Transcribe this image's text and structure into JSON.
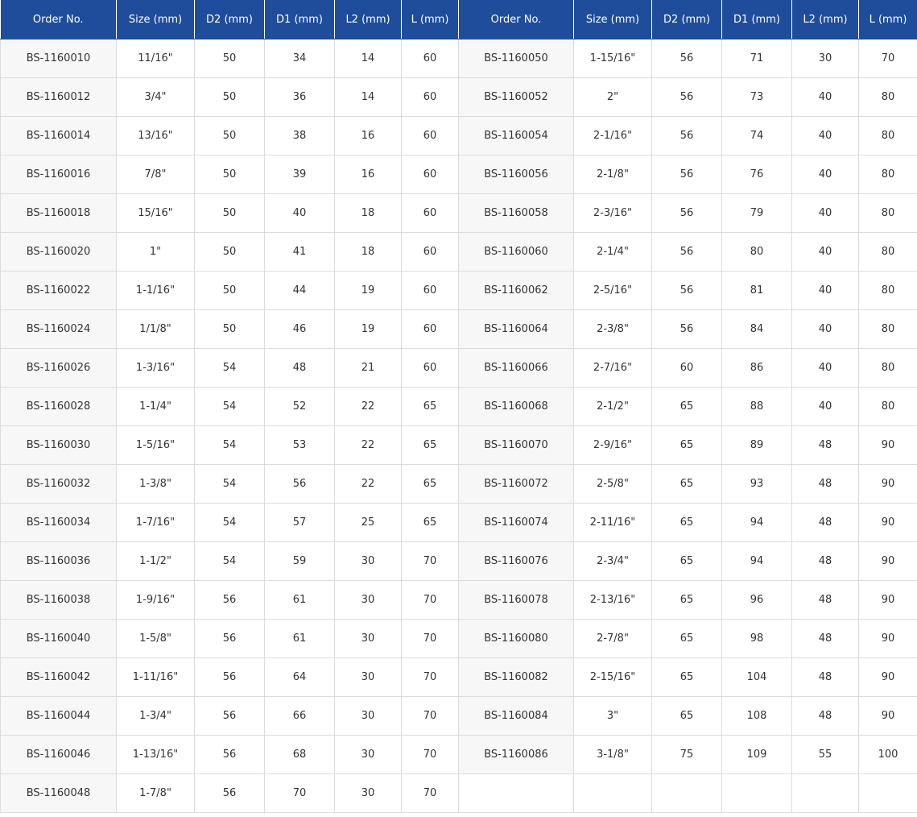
{
  "headers": [
    "Order No.",
    "Size (mm)",
    "D2 (mm)",
    "D1 (mm)",
    "L2 (mm)",
    "L (mm)",
    "Order No.",
    "Size (mm)",
    "D2 (mm)",
    "D1 (mm)",
    "L2 (mm)",
    "L (mm)"
  ],
  "rows": [
    [
      "BS-1160010",
      "11/16\"",
      "50",
      "34",
      "14",
      "60",
      "BS-1160050",
      "1-15/16\"",
      "56",
      "71",
      "30",
      "70"
    ],
    [
      "BS-1160012",
      "3/4\"",
      "50",
      "36",
      "14",
      "60",
      "BS-1160052",
      "2\"",
      "56",
      "73",
      "40",
      "80"
    ],
    [
      "BS-1160014",
      "13/16\"",
      "50",
      "38",
      "16",
      "60",
      "BS-1160054",
      "2-1/16\"",
      "56",
      "74",
      "40",
      "80"
    ],
    [
      "BS-1160016",
      "7/8\"",
      "50",
      "39",
      "16",
      "60",
      "BS-1160056",
      "2-1/8\"",
      "56",
      "76",
      "40",
      "80"
    ],
    [
      "BS-1160018",
      "15/16\"",
      "50",
      "40",
      "18",
      "60",
      "BS-1160058",
      "2-3/16\"",
      "56",
      "79",
      "40",
      "80"
    ],
    [
      "BS-1160020",
      "1\"",
      "50",
      "41",
      "18",
      "60",
      "BS-1160060",
      "2-1/4\"",
      "56",
      "80",
      "40",
      "80"
    ],
    [
      "BS-1160022",
      "1-1/16\"",
      "50",
      "44",
      "19",
      "60",
      "BS-1160062",
      "2-5/16\"",
      "56",
      "81",
      "40",
      "80"
    ],
    [
      "BS-1160024",
      "1/1/8\"",
      "50",
      "46",
      "19",
      "60",
      "BS-1160064",
      "2-3/8\"",
      "56",
      "84",
      "40",
      "80"
    ],
    [
      "BS-1160026",
      "1-3/16\"",
      "54",
      "48",
      "21",
      "60",
      "BS-1160066",
      "2-7/16\"",
      "60",
      "86",
      "40",
      "80"
    ],
    [
      "BS-1160028",
      "1-1/4\"",
      "54",
      "52",
      "22",
      "65",
      "BS-1160068",
      "2-1/2\"",
      "65",
      "88",
      "40",
      "80"
    ],
    [
      "BS-1160030",
      "1-5/16\"",
      "54",
      "53",
      "22",
      "65",
      "BS-1160070",
      "2-9/16\"",
      "65",
      "89",
      "48",
      "90"
    ],
    [
      "BS-1160032",
      "1-3/8\"",
      "54",
      "56",
      "22",
      "65",
      "BS-1160072",
      "2-5/8\"",
      "65",
      "93",
      "48",
      "90"
    ],
    [
      "BS-1160034",
      "1-7/16\"",
      "54",
      "57",
      "25",
      "65",
      "BS-1160074",
      "2-11/16\"",
      "65",
      "94",
      "48",
      "90"
    ],
    [
      "BS-1160036",
      "1-1/2\"",
      "54",
      "59",
      "30",
      "70",
      "BS-1160076",
      "2-3/4\"",
      "65",
      "94",
      "48",
      "90"
    ],
    [
      "BS-1160038",
      "1-9/16\"",
      "56",
      "61",
      "30",
      "70",
      "BS-1160078",
      "2-13/16\"",
      "65",
      "96",
      "48",
      "90"
    ],
    [
      "BS-1160040",
      "1-5/8\"",
      "56",
      "61",
      "30",
      "70",
      "BS-1160080",
      "2-7/8\"",
      "65",
      "98",
      "48",
      "90"
    ],
    [
      "BS-1160042",
      "1-11/16\"",
      "56",
      "64",
      "30",
      "70",
      "BS-1160082",
      "2-15/16\"",
      "65",
      "104",
      "48",
      "90"
    ],
    [
      "BS-1160044",
      "1-3/4\"",
      "56",
      "66",
      "30",
      "70",
      "BS-1160084",
      "3\"",
      "65",
      "108",
      "48",
      "90"
    ],
    [
      "BS-1160046",
      "1-13/16\"",
      "56",
      "68",
      "30",
      "70",
      "BS-1160086",
      "3-1/8\"",
      "75",
      "109",
      "55",
      "100"
    ],
    [
      "BS-1160048",
      "1-7/8\"",
      "56",
      "70",
      "30",
      "70",
      "",
      "",
      "",
      "",
      "",
      ""
    ]
  ],
  "colors": {
    "header_bg": "#1f4d9b",
    "header_text": "#ffffff",
    "order_cell_bg": "#f7f7f7",
    "grid": "#dcdcdc"
  }
}
